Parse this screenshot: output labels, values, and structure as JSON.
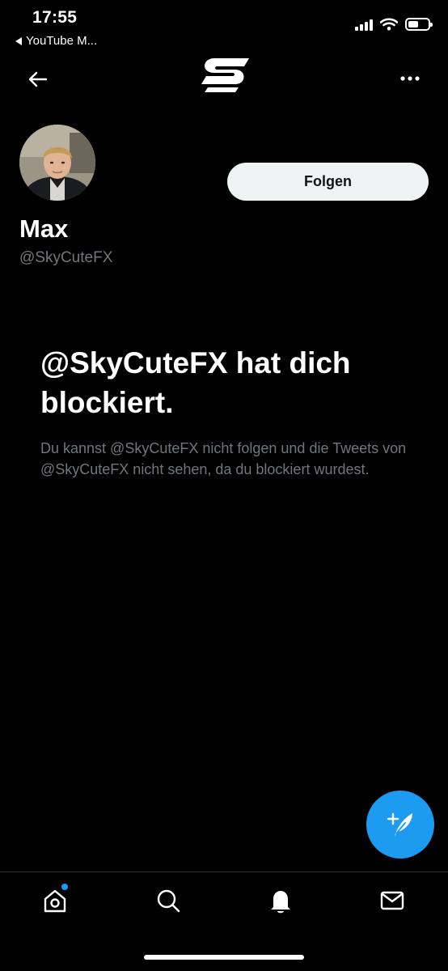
{
  "status_bar": {
    "time": "17:55",
    "back_app": "YouTube M..."
  },
  "header": {
    "back_icon": "arrow-left-icon",
    "logo_icon": "s-logo-icon",
    "more_icon": "more-horizontal-icon"
  },
  "profile": {
    "display_name": "Max",
    "handle": "@SkyCuteFX",
    "follow_label": "Folgen"
  },
  "blocked": {
    "title": "@SkyCuteFX hat dich blockiert.",
    "body": "Du kannst @SkyCuteFX nicht folgen und die Tweets von @SkyCuteFX nicht sehen, da du blockiert wurdest."
  },
  "tabbar": {
    "items": [
      "home-icon",
      "search-icon",
      "bell-icon",
      "mail-icon"
    ]
  },
  "colors": {
    "accent": "#1d9bf0",
    "background": "#000000",
    "secondary_text": "#71767b",
    "button_bg": "#eff3f4"
  }
}
